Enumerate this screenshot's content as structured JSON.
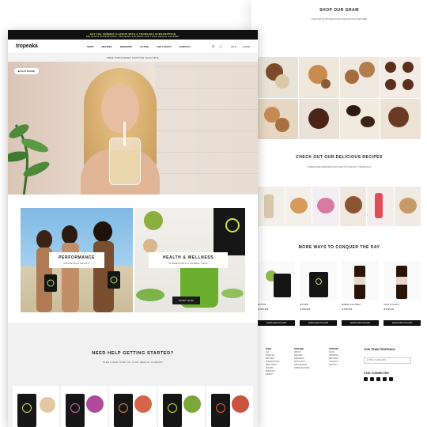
{
  "announcement": {
    "line1": "GET THE SUMMER GLOWUP WITH A TROPEAKA SUBSCRIPTION",
    "line2": "DELICIOUS SUPERFOODS, PROTEINS & BLENDS FOR YOUR HEALTH JOURNEY"
  },
  "header": {
    "logo": "tropeaka",
    "menu": [
      "SHOP",
      "RECIPES",
      "REWARDS",
      "ACTIVE",
      "THE LATEST",
      "CONTACT"
    ],
    "currency": "AU $",
    "login": "LOGIN"
  },
  "shipping_bar": "FREE WORLDWIDE SHIPPING AVAILABLE",
  "hero": {
    "play_label": "PLAY SOUND"
  },
  "tiles": {
    "left": {
      "title": "PERFORMANCE",
      "subtitle": "PROTEINS & BCAA'S"
    },
    "right": {
      "title": "HEALTH & WELLNESS",
      "subtitle": "SUPERFOODS & HERBAL TEAS",
      "button": "SHOP NOW"
    }
  },
  "help": {
    "title": "NEED HELP GETTING STARTED?",
    "subtitle": "TAKE A NEW STEP ON YOUR HEALTH JOURNEY"
  },
  "gram": {
    "title": "SHOP OUR GRAM",
    "subtitle": "FOLLOW @TROPEAKA #CONSCIOUSTOGETHER"
  },
  "recipes": {
    "title": "CHECK OUT OUR DELICIOUS RECIPES",
    "subtitle": "THERE ARE ENDLESS FUN WAYS TO ENJOY TROPEAKA"
  },
  "more": {
    "title": "MORE WAYS TO CONQUER THE DAY",
    "products": [
      {
        "name": "MATCHA",
        "stars": "★★★★★",
        "button": "QUICK ADD TO CART"
      },
      {
        "name": "PROTEIN",
        "stars": "★★★★★",
        "button": "QUICK ADD TO CART"
      },
      {
        "name": "MARINE COLLAGEN",
        "stars": "★★★★★",
        "button": "QUICK ADD TO CART"
      },
      {
        "name": "CALM & CLARITY",
        "stars": "★★★★★",
        "button": "QUICK ADD TO CART"
      }
    ]
  },
  "footer": {
    "col1": {
      "title": "SHOP",
      "items": [
        "ALL",
        "SHOP ALL",
        "PROTEIN",
        "SUPERFOODS",
        "WELLNESS",
        "BLENDS",
        "BUNDLES",
        "MERCH"
      ]
    },
    "col2": {
      "title": "EXPLORE",
      "items": [
        "ABOUT",
        "RECIPES",
        "REWARDS",
        "STOCKISTS",
        "WHOLESALE",
        "AMBASSADORS"
      ]
    },
    "col3": {
      "title": "SUPPORT",
      "items": [
        "FAQS",
        "SHIPPING",
        "RETURNS",
        "CONTACT",
        "PRIVACY"
      ]
    },
    "join": {
      "title": "JOIN TEAM TROPEAKA",
      "placeholder": "ENTER YOUR EMAIL",
      "stay": "STAY CONNECTED"
    }
  },
  "colors": {
    "accent": "#d4e84a",
    "dark": "#111111"
  }
}
